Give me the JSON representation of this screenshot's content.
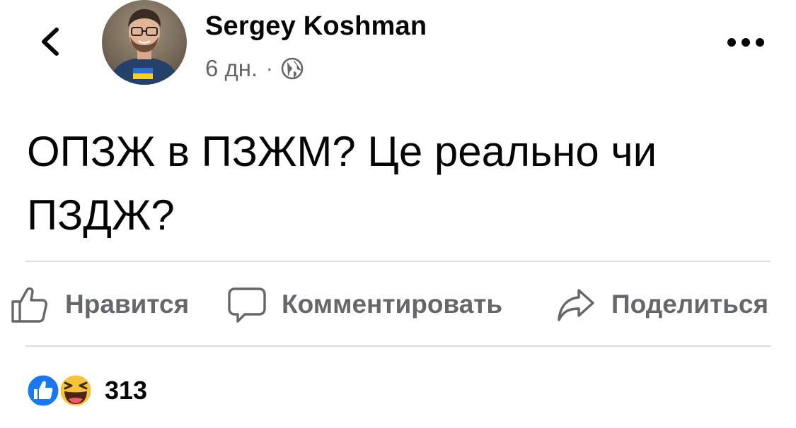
{
  "post": {
    "author": "Sergey Koshman",
    "time": "6 дн.",
    "separator": "·",
    "privacy_icon": "globe-icon",
    "text": "ОПЗЖ в ПЗЖМ? Це реально чи ПЗДЖ?"
  },
  "header": {
    "back_icon": "chevron-left-icon",
    "more_icon": "more-dots-icon"
  },
  "actions": {
    "like_label": "Нравится",
    "comment_label": "Комментировать",
    "share_label": "Поделиться"
  },
  "reactions": {
    "types": [
      "like",
      "haha"
    ],
    "count": "313"
  },
  "colors": {
    "secondary_text": "#65676b",
    "like_blue": "#1877f2",
    "haha_yellow": "#f7c33b",
    "divider": "#dcdde0"
  }
}
